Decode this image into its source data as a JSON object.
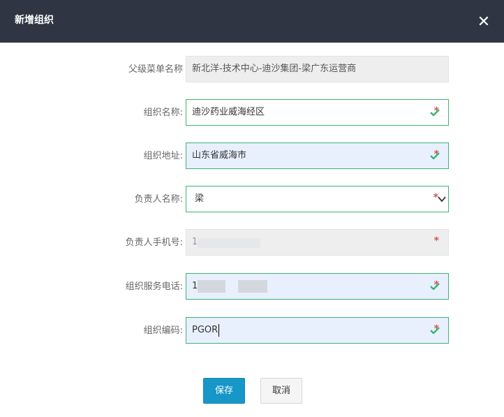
{
  "dialog": {
    "title": "新增组织",
    "close_glyph": "✕"
  },
  "form": {
    "parent_menu": {
      "label": "父级菜单名称",
      "value": "新北洋-技术中心-迪沙集团-梁广东运营商"
    },
    "org_name": {
      "label": "组织名称:",
      "value": "迪沙药业威海经区"
    },
    "org_address": {
      "label": "组织地址:",
      "value": "山东省威海市"
    },
    "owner_name": {
      "label": "负责人名称:",
      "value": "梁"
    },
    "owner_phone": {
      "label": "负责人手机号:",
      "value": "1"
    },
    "service_phone": {
      "label": "组织服务电话:",
      "value": "1"
    },
    "org_code": {
      "label": "组织编码:",
      "value": "PGOR"
    },
    "required_mark": "*"
  },
  "actions": {
    "save": "保存",
    "cancel": "取消"
  },
  "colors": {
    "header": "#2f3542",
    "valid_border": "#3cb371",
    "primary": "#1796c8",
    "required": "#d9534f"
  },
  "icons": [
    "close-icon",
    "check-icon",
    "chevron-down-icon"
  ]
}
